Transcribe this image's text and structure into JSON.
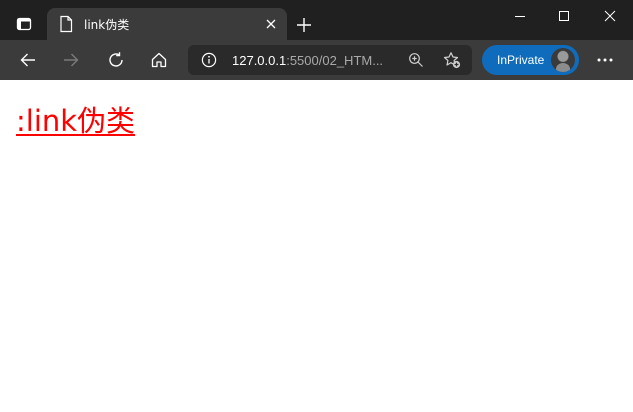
{
  "browser": {
    "tab": {
      "title": "link伪类"
    },
    "address_bar": {
      "url_host": "127.0.0.1",
      "url_path": ":5500/02_HTM..."
    },
    "profile": {
      "label": "InPrivate"
    },
    "colors": {
      "titlebar": "#202020",
      "toolbar": "#3b3b3b",
      "inprivate_badge": "#0f6cbd"
    }
  },
  "page": {
    "link_text": ":link伪类",
    "link_color": "#ff0000"
  }
}
